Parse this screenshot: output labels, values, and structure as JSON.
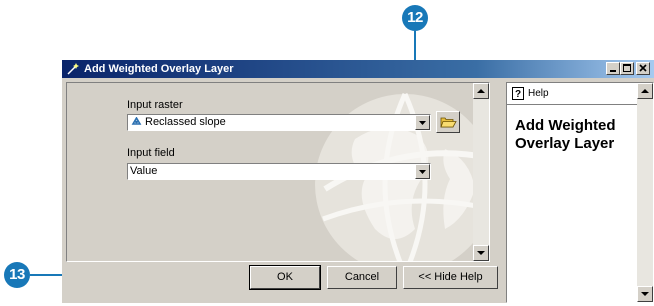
{
  "callouts": {
    "top": "12",
    "bottom": "13"
  },
  "window": {
    "title": "Add Weighted Overlay Layer"
  },
  "form": {
    "input_raster_label": "Input raster",
    "input_raster_value": "Reclassed slope",
    "input_field_label": "Input field",
    "input_field_value": "Value"
  },
  "buttons": {
    "ok": "OK",
    "cancel": "Cancel",
    "hide_help": "<< Hide Help"
  },
  "help": {
    "tab_label": "Help",
    "title": "Add Weighted Overlay Layer"
  },
  "colors": {
    "callout": "#1878b8",
    "title_bar": "#0a246a",
    "face": "#d4d0c8"
  }
}
